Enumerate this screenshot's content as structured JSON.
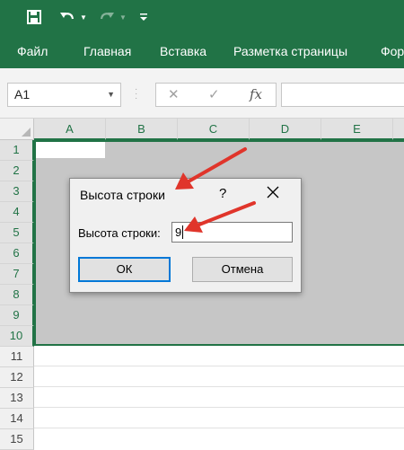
{
  "quick_access": {
    "save_icon": "save-icon",
    "undo_icon": "undo-icon",
    "redo_icon": "redo-icon",
    "customize_icon": "customize-qat-icon"
  },
  "ribbon": {
    "tabs": [
      "Файл",
      "Главная",
      "Вставка",
      "Разметка страницы",
      "Фор"
    ]
  },
  "formula_bar": {
    "name_box": "A1",
    "cancel_symbol": "✕",
    "enter_symbol": "✓",
    "fx_label": "fx",
    "value": ""
  },
  "grid": {
    "columns": [
      "A",
      "B",
      "C",
      "D",
      "E"
    ],
    "rows": [
      "1",
      "2",
      "3",
      "4",
      "5",
      "6",
      "7",
      "8",
      "9",
      "10",
      "11",
      "12",
      "13",
      "14",
      "15"
    ],
    "selected_rows": 10
  },
  "dialog": {
    "title": "Высота строки",
    "help": "?",
    "close": "✕",
    "field_label": "Высота строки:",
    "field_value": "9",
    "ok_label": "ОК",
    "cancel_label": "Отмена"
  },
  "colors": {
    "excel_green": "#217346",
    "selection_fill": "#c6c6c6",
    "arrow_red": "#e0352b",
    "focus_blue": "#0078d7"
  }
}
